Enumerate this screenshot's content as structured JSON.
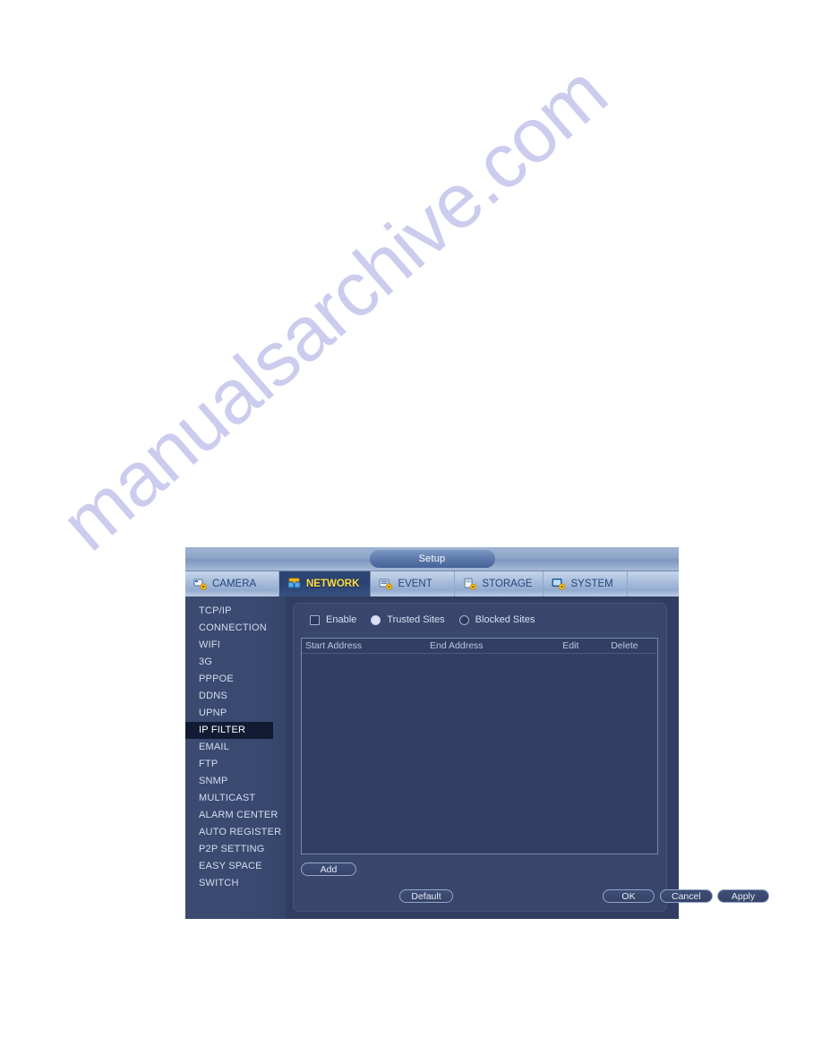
{
  "page": {
    "watermark_text": "manualsarchive.com",
    "watermark_color": "#ccccee",
    "background_color": "#ffffff"
  },
  "window": {
    "title": "Setup"
  },
  "tabs": [
    {
      "label": "CAMERA",
      "icon": "camera-gear-icon",
      "active": false
    },
    {
      "label": "NETWORK",
      "icon": "network-icon",
      "active": true
    },
    {
      "label": "EVENT",
      "icon": "event-gear-icon",
      "active": false
    },
    {
      "label": "STORAGE",
      "icon": "storage-gear-icon",
      "active": false
    },
    {
      "label": "SYSTEM",
      "icon": "system-gear-icon",
      "active": false
    }
  ],
  "sidebar": {
    "selected": "IP FILTER",
    "items": [
      {
        "label": "TCP/IP"
      },
      {
        "label": "CONNECTION"
      },
      {
        "label": "WIFI"
      },
      {
        "label": "3G"
      },
      {
        "label": "PPPOE"
      },
      {
        "label": "DDNS"
      },
      {
        "label": "UPNP"
      },
      {
        "label": "IP FILTER"
      },
      {
        "label": "EMAIL"
      },
      {
        "label": "FTP"
      },
      {
        "label": "SNMP"
      },
      {
        "label": "MULTICAST"
      },
      {
        "label": "ALARM CENTER"
      },
      {
        "label": "AUTO REGISTER"
      },
      {
        "label": "P2P SETTING"
      },
      {
        "label": "EASY SPACE"
      },
      {
        "label": "SWITCH"
      }
    ]
  },
  "main": {
    "options": {
      "enable_label": "Enable",
      "enable_checked": false,
      "trusted_label": "Trusted Sites",
      "trusted_selected": true,
      "blocked_label": "Blocked Sites",
      "blocked_selected": false
    },
    "table": {
      "columns": [
        {
          "key": "start_address",
          "label": "Start Address"
        },
        {
          "key": "end_address",
          "label": "End Address"
        },
        {
          "key": "edit",
          "label": "Edit"
        },
        {
          "key": "delete",
          "label": "Delete"
        }
      ],
      "rows": []
    },
    "add_button_label": "Add"
  },
  "footer": {
    "default_label": "Default",
    "ok_label": "OK",
    "cancel_label": "Cancel",
    "apply_label": "Apply"
  },
  "colors": {
    "panel_bg": "#313e62",
    "card_bg": "#39476c",
    "sidebar_bg": "#3a4970",
    "selected_item_bg": "#121b33",
    "active_tab_text": "#ffdd44",
    "body_text": "#d6dff1"
  }
}
